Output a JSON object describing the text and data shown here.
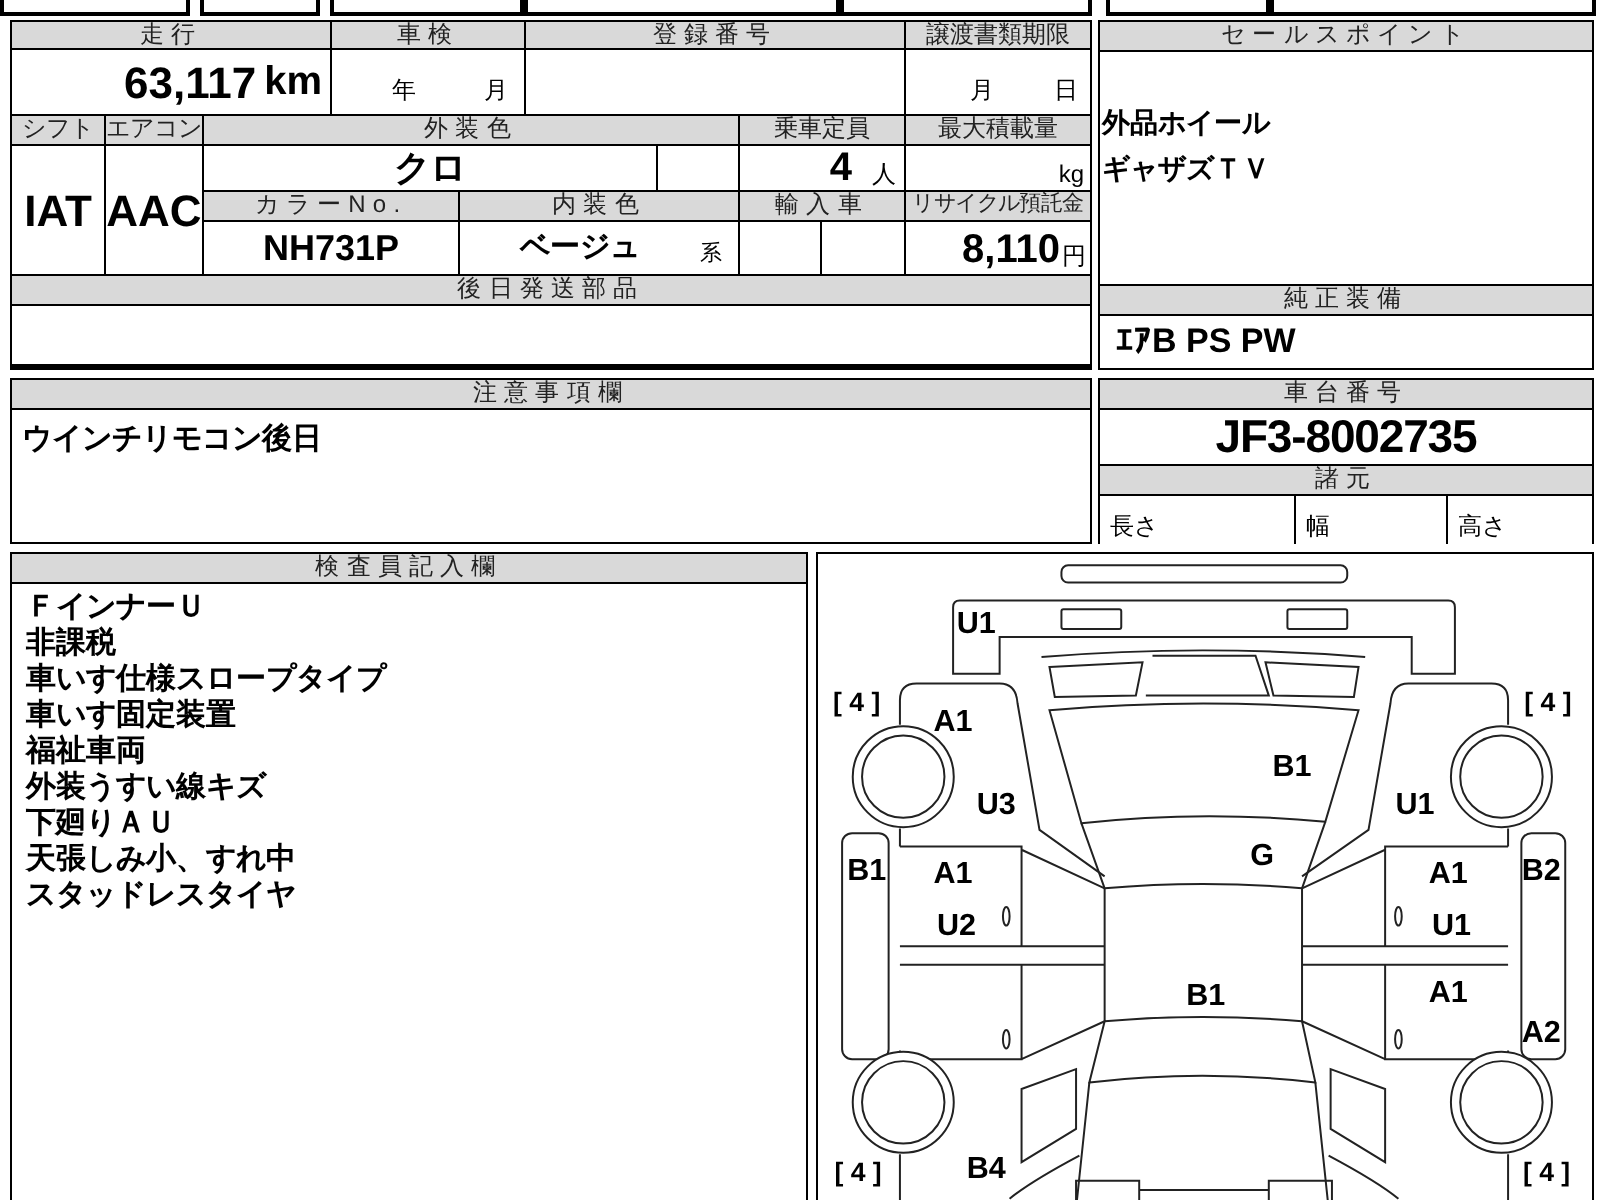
{
  "vehicle_info": {
    "mileage_label": "走行",
    "mileage": "63,117",
    "mileage_unit": "km",
    "inspection_label": "車検",
    "inspection_year_unit": "年",
    "inspection_month_unit": "月",
    "registration_label": "登録番号",
    "transfer_deadline_label": "譲渡書類期限",
    "transfer_month_unit": "月",
    "transfer_day_unit": "日",
    "shift_label": "シフト",
    "shift": "IAT",
    "aircon_label": "エアコン",
    "aircon": "AAC",
    "exterior_color_label": "外装色",
    "exterior_color": "クロ",
    "capacity_label": "乗車定員",
    "capacity": "4",
    "capacity_unit": "人",
    "max_load_label": "最大積載量",
    "max_load_unit": "kg",
    "color_no_label": "カラーNo.",
    "color_no": "NH731P",
    "interior_color_label": "内装色",
    "interior_color": "ベージュ",
    "interior_color_suffix": "系",
    "import_label": "輸入車",
    "recycle_fee_label": "リサイクル預託金",
    "recycle_fee": "8,110",
    "recycle_fee_unit": "円",
    "later_parts_label": "後日発送部品"
  },
  "sale_points": {
    "label": "セールスポイント",
    "lines": [
      "外品ホイール",
      "ギャザズＴＶ"
    ]
  },
  "genuine_equipment": {
    "label": "純正装備",
    "value": "ｴｱB PS PW"
  },
  "notes": {
    "label": "注意事項欄",
    "text": "ウインチリモコン後日"
  },
  "chassis": {
    "label": "車台番号",
    "value": "JF3-8002735",
    "specs_label": "諸元",
    "specs": [
      "長さ",
      "幅",
      "高さ"
    ]
  },
  "inspector_notes": {
    "label": "検査員記入欄",
    "lines": [
      "ＦインナーＵ",
      "非課税",
      "車いす仕様スロープタイプ",
      "車いす固定装置",
      "福祉車両",
      "外装うすい線キズ",
      "下廻りＡＵ",
      "天張しみ小、すれ中",
      "スタッドレスタイヤ"
    ]
  },
  "damage_diagram": {
    "marks": [
      {
        "kind": "code",
        "text": "U1"
      },
      {
        "kind": "tread",
        "text": "[ 4 ]"
      },
      {
        "kind": "tread",
        "text": "[ 4 ]"
      },
      {
        "kind": "code",
        "text": "A1"
      },
      {
        "kind": "code",
        "text": "B1"
      },
      {
        "kind": "code",
        "text": "U3"
      },
      {
        "kind": "code",
        "text": "U1"
      },
      {
        "kind": "code",
        "text": "B1"
      },
      {
        "kind": "code",
        "text": "A1"
      },
      {
        "kind": "code",
        "text": "G"
      },
      {
        "kind": "code",
        "text": "A1"
      },
      {
        "kind": "code",
        "text": "B2"
      },
      {
        "kind": "code",
        "text": "U2"
      },
      {
        "kind": "code",
        "text": "U1"
      },
      {
        "kind": "code",
        "text": "B1"
      },
      {
        "kind": "code",
        "text": "A1"
      },
      {
        "kind": "code",
        "text": "A2"
      },
      {
        "kind": "tread",
        "text": "[ 4 ]"
      },
      {
        "kind": "code",
        "text": "B4"
      },
      {
        "kind": "tread",
        "text": "[ 4 ]"
      }
    ]
  }
}
